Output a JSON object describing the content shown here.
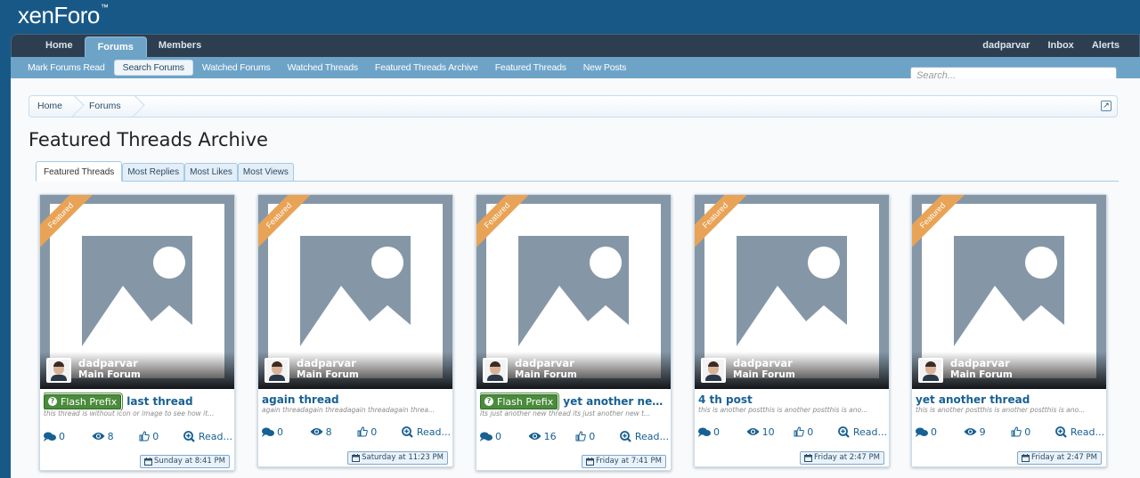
{
  "logo": {
    "text": "xenForo",
    "sup": "™"
  },
  "nav": {
    "tabs": [
      "Home",
      "Forums",
      "Members"
    ],
    "selected": "Forums",
    "right": [
      "dadparvar",
      "Inbox",
      "Alerts"
    ]
  },
  "subnav": [
    "Mark Forums Read",
    "Search Forums",
    "Watched Forums",
    "Watched Threads",
    "Featured Threads Archive",
    "Featured Threads",
    "New Posts"
  ],
  "search": {
    "placeholder": "Search..."
  },
  "breadcrumb": [
    "Home",
    "Forums"
  ],
  "page_title": "Featured Threads Archive",
  "tabs": [
    "Featured Threads",
    "Most Replies",
    "Most Likes",
    "Most Views"
  ],
  "ribbon_label": "Featured",
  "read_label": "Read...",
  "colors": {
    "header": "#185886",
    "nav": "#2c3e4f",
    "subnav": "#6ea3c8",
    "ribbon": "#e9a356",
    "prefix": "#4a8b3c",
    "link": "#176093"
  },
  "cards": [
    {
      "user": "dadparvar",
      "forum": "Main Forum",
      "prefix": "Flash Prefix",
      "title": "last thread",
      "desc": "this thread is without icon or image to see how it...",
      "replies": "0",
      "views": "8",
      "likes": "0",
      "date": "Sunday at 8:41 PM"
    },
    {
      "user": "dadparvar",
      "forum": "Main Forum",
      "prefix": "",
      "title": "again thread",
      "desc": "again threadagain threadagain threadagain threa...",
      "replies": "0",
      "views": "8",
      "likes": "0",
      "date": "Saturday at 11:23 PM"
    },
    {
      "user": "dadparvar",
      "forum": "Main Forum",
      "prefix": "Flash Prefix",
      "title": "yet another new..",
      "desc": "its just another new thread its just another new t...",
      "replies": "0",
      "views": "16",
      "likes": "0",
      "date": "Friday at 7:41 PM"
    },
    {
      "user": "dadparvar",
      "forum": "Main Forum",
      "prefix": "",
      "title": "4 th post",
      "desc": "this is another postthis is another postthis is ano...",
      "replies": "0",
      "views": "10",
      "likes": "0",
      "date": "Friday at 2:47 PM"
    },
    {
      "user": "dadparvar",
      "forum": "Main Forum",
      "prefix": "",
      "title": "yet another thread",
      "desc": "this is another postthis is another postthis is ano...",
      "replies": "0",
      "views": "9",
      "likes": "0",
      "date": "Friday at 2:47 PM"
    }
  ]
}
